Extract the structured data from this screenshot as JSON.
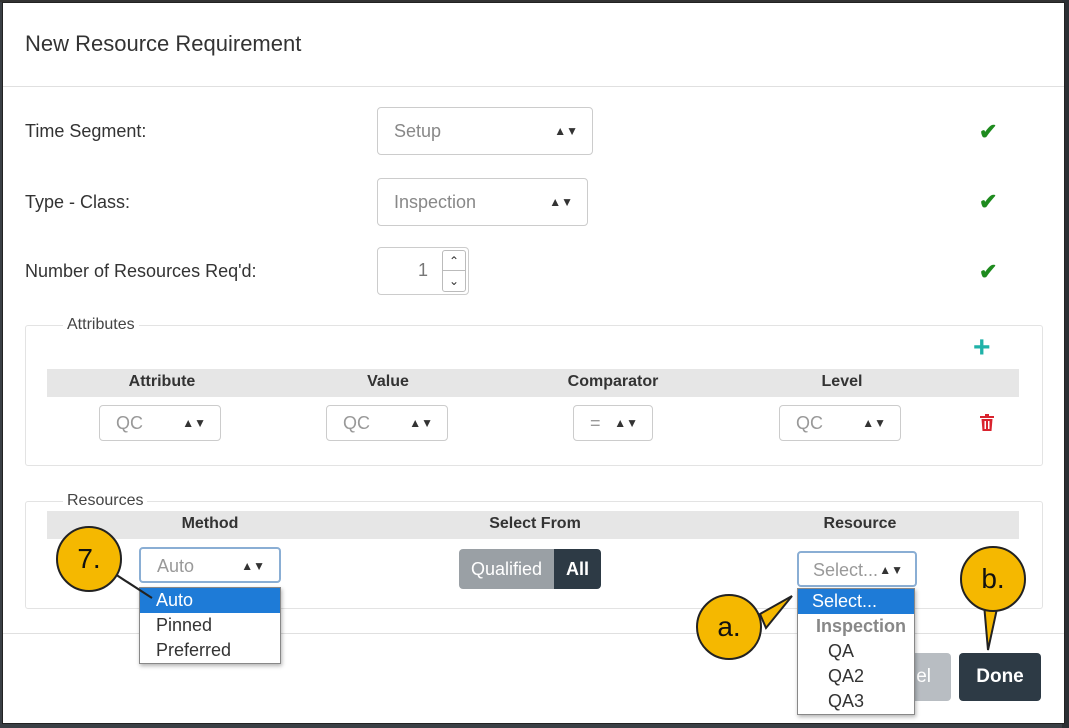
{
  "modal": {
    "title": "New Resource Requirement"
  },
  "fields": {
    "time_segment": {
      "label": "Time Segment:",
      "value": "Setup"
    },
    "type_class": {
      "label": "Type - Class:",
      "value": "Inspection"
    },
    "num_resources": {
      "label": "Number of Resources Req'd:",
      "value": "1"
    }
  },
  "attributes": {
    "legend": "Attributes",
    "columns": [
      "Attribute",
      "Value",
      "Comparator",
      "Level"
    ],
    "row": {
      "attribute": "QC",
      "value": "QC",
      "comparator": "=",
      "level": "QC"
    }
  },
  "resources": {
    "legend": "Resources",
    "columns": [
      "Method",
      "Select From",
      "Resource"
    ],
    "method_value": "Auto",
    "select_from": {
      "option1": "Qualified",
      "option2": "All",
      "active": "All"
    },
    "resource_value": "Select..."
  },
  "method_dropdown": [
    "Auto",
    "Pinned",
    "Preferred"
  ],
  "resource_dropdown": {
    "placeholder": "Select...",
    "group": "Inspection",
    "items": [
      "QA",
      "QA2",
      "QA3"
    ]
  },
  "footer": {
    "cancel_label": "el",
    "done_label": "Done"
  },
  "callouts": {
    "seven": "7.",
    "a": "a.",
    "b": "b."
  },
  "colors": {
    "check": "#1e8b1e",
    "plus": "#20b2a8",
    "trash": "#d9232e",
    "callout": "#f5b800",
    "done": "#2d3a45",
    "selected": "#1e7bd7"
  }
}
